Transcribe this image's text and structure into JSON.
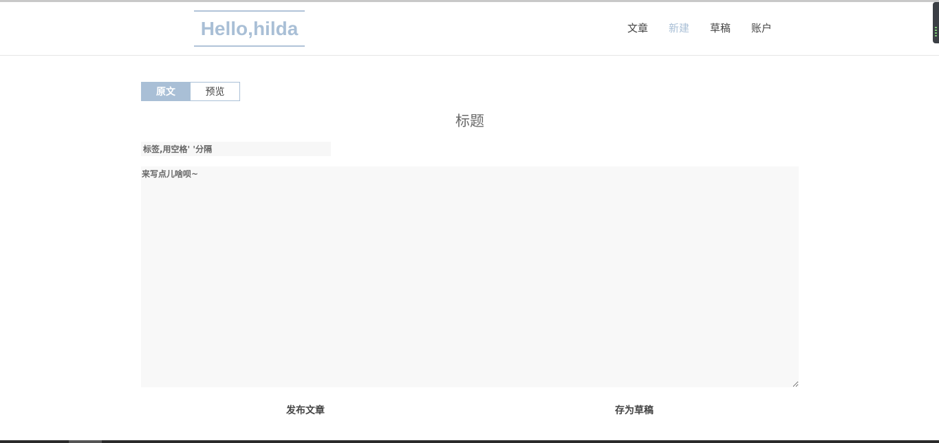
{
  "header": {
    "logo": "Hello,hilda",
    "nav": [
      {
        "label": "文章",
        "active": false
      },
      {
        "label": "新建",
        "active": true
      },
      {
        "label": "草稿",
        "active": false
      },
      {
        "label": "账户",
        "active": false
      }
    ]
  },
  "editor": {
    "tabs": {
      "source": "原文",
      "preview": "预览"
    },
    "title_placeholder": "标题",
    "tags_placeholder": "标签,用空格' '分隔",
    "content_placeholder": "来写点儿啥呗~"
  },
  "actions": {
    "publish": "发布文章",
    "save_draft": "存为草稿"
  },
  "colors": {
    "accent": "#a9bfd6",
    "text": "#444444",
    "field_bg": "#f8f8f8"
  }
}
